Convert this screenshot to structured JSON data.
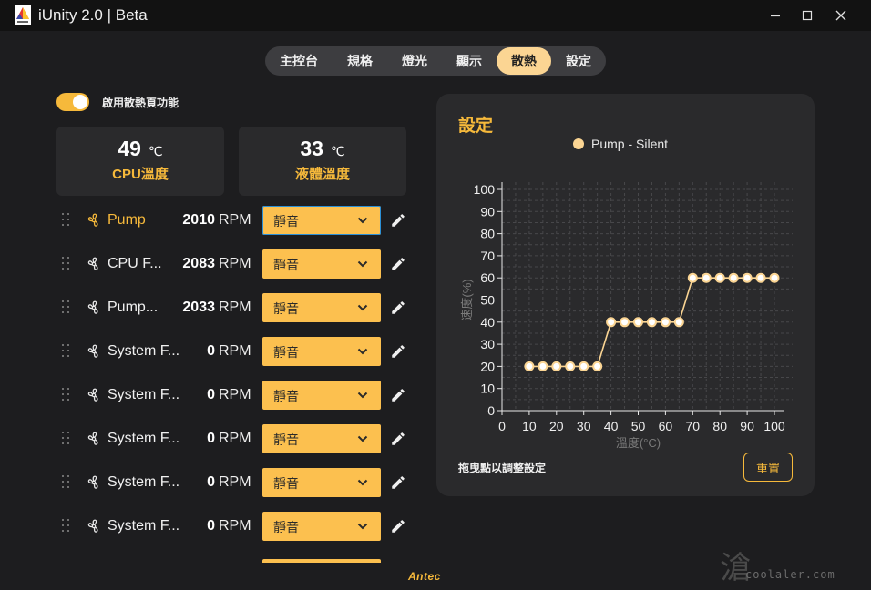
{
  "window": {
    "title": "iUnity 2.0 | Beta"
  },
  "tabs": [
    {
      "label": "主控台"
    },
    {
      "label": "規格"
    },
    {
      "label": "燈光"
    },
    {
      "label": "顯示"
    },
    {
      "label": "散熱",
      "active": true
    },
    {
      "label": "設定"
    }
  ],
  "toggle": {
    "label": "啟用散熱頁功能",
    "on": true
  },
  "temps": {
    "cpu": {
      "value": "49",
      "unit": "℃",
      "label": "CPU溫度"
    },
    "liquid": {
      "value": "33",
      "unit": "℃",
      "label": "液體溫度"
    }
  },
  "fans": [
    {
      "name": "Pump",
      "rpm": "2010",
      "unit": "RPM",
      "mode": "靜音",
      "active": true
    },
    {
      "name": "CPU F...",
      "rpm": "2083",
      "unit": "RPM",
      "mode": "靜音"
    },
    {
      "name": "Pump...",
      "rpm": "2033",
      "unit": "RPM",
      "mode": "靜音"
    },
    {
      "name": "System F...",
      "rpm": "0",
      "unit": "RPM",
      "mode": "靜音"
    },
    {
      "name": "System F...",
      "rpm": "0",
      "unit": "RPM",
      "mode": "靜音"
    },
    {
      "name": "System F...",
      "rpm": "0",
      "unit": "RPM",
      "mode": "靜音"
    },
    {
      "name": "System F...",
      "rpm": "0",
      "unit": "RPM",
      "mode": "靜音"
    },
    {
      "name": "System F...",
      "rpm": "0",
      "unit": "RPM",
      "mode": "靜音"
    }
  ],
  "panel": {
    "title": "設定",
    "hint": "拖曳點以調整設定",
    "reset_label": "重置"
  },
  "chart_data": {
    "type": "line",
    "series": [
      {
        "name": "Pump - Silent",
        "x": [
          10,
          15,
          20,
          25,
          30,
          35,
          40,
          45,
          50,
          55,
          60,
          65,
          70,
          75,
          80,
          85,
          90,
          95,
          100
        ],
        "y": [
          20,
          20,
          20,
          20,
          20,
          20,
          40,
          40,
          40,
          40,
          40,
          40,
          60,
          60,
          60,
          60,
          60,
          60,
          60
        ]
      }
    ],
    "xlabel": "溫度(°C)",
    "ylabel": "速度(%)",
    "xlim": [
      0,
      100
    ],
    "ylim": [
      0,
      100
    ],
    "xticks": [
      "0",
      "10",
      "20",
      "30",
      "40",
      "50",
      "60",
      "70",
      "80",
      "90",
      "100"
    ],
    "yticks": [
      "0",
      "10",
      "20",
      "30",
      "40",
      "50",
      "60",
      "70",
      "80",
      "90",
      "100"
    ],
    "grid": true,
    "legend": "top-center",
    "line_color": "#fbd593"
  },
  "footer": {
    "brand": "Antec",
    "watermark": "coolaler.com",
    "watermark_glyph": "滄"
  },
  "colors": {
    "accent": "#f6b93b",
    "accent_light": "#fbd593",
    "select": "#fcc04f",
    "panel": "#2a2a2c",
    "background": "#1d1d1f"
  }
}
